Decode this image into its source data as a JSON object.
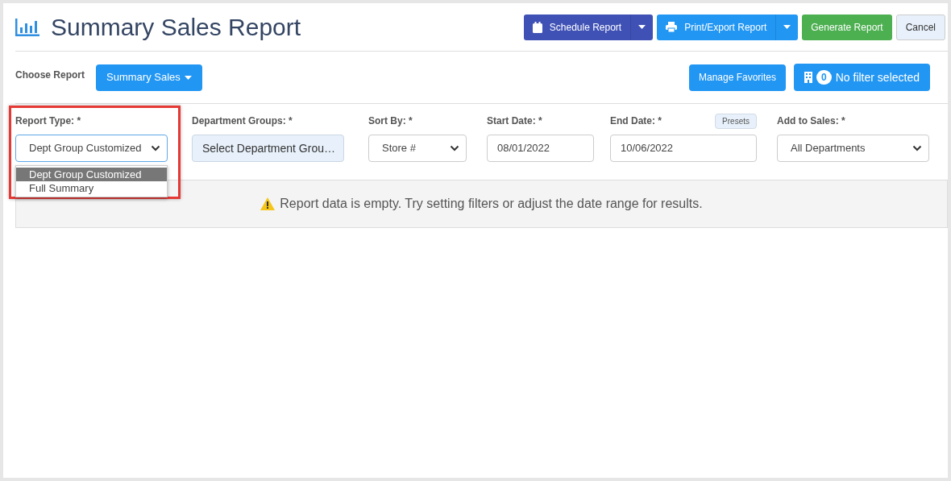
{
  "title": "Summary Sales Report",
  "header_buttons": [
    {
      "label": "Schedule Report",
      "kind": "split",
      "color": "#3f51b5"
    },
    {
      "label": "Print/Export Report",
      "kind": "split",
      "color": "#2196f3"
    },
    {
      "label": "Generate Report",
      "kind": "plain",
      "color": "#4caf50"
    },
    {
      "label": "Cancel",
      "kind": "light",
      "color": "#e8f1fb"
    }
  ],
  "choose_report": {
    "label": "Choose Report",
    "value": "Summary Sales"
  },
  "manage_favorites": "Manage Favorites",
  "filter": {
    "count": "0",
    "label": "No filter selected"
  },
  "fields": [
    {
      "label": "Report Type: *",
      "kind": "select",
      "value": "Dept Group Customized",
      "highlighted": true,
      "expanded": true,
      "options": [
        {
          "label": "Dept Group Customized",
          "selected": true
        },
        {
          "label": "Full Summary",
          "selected": false
        }
      ]
    },
    {
      "label": "Department Groups: *",
      "kind": "button",
      "value": "Select Department Grou…"
    },
    {
      "label": "Sort By: *",
      "kind": "select",
      "value": "Store #"
    },
    {
      "label": "Start Date: *",
      "kind": "date",
      "value": "08/01/2022"
    },
    {
      "label": "End Date: *",
      "kind": "date",
      "value": "10/06/2022",
      "presets": "Presets"
    },
    {
      "label": "Add to Sales: *",
      "kind": "select",
      "value": "All Departments"
    }
  ],
  "message": "Report data is empty. Try setting filters or adjust the date range for results."
}
